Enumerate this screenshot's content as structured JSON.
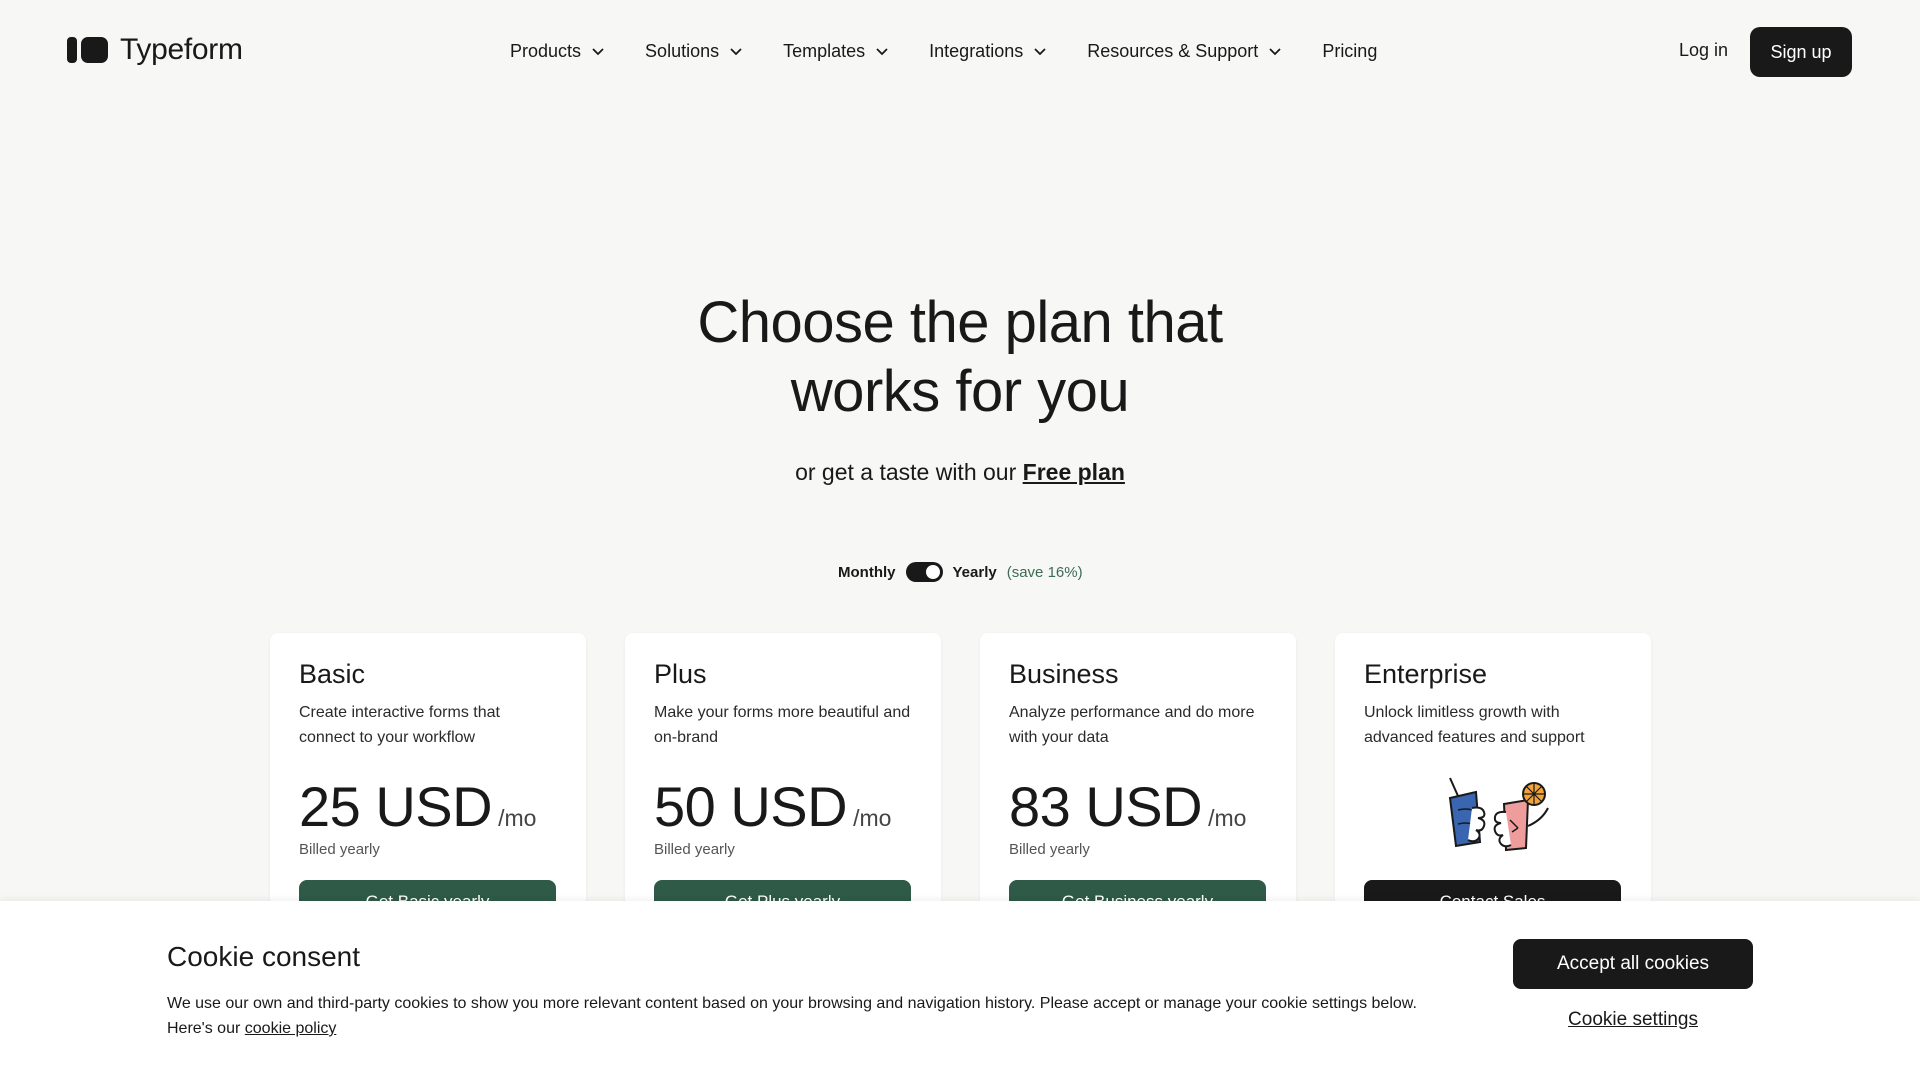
{
  "brand": {
    "name": "Typeform"
  },
  "nav": {
    "items": [
      {
        "label": "Products",
        "dropdown": true
      },
      {
        "label": "Solutions",
        "dropdown": true
      },
      {
        "label": "Templates",
        "dropdown": true
      },
      {
        "label": "Integrations",
        "dropdown": true
      },
      {
        "label": "Resources & Support",
        "dropdown": true
      },
      {
        "label": "Pricing",
        "dropdown": false
      }
    ],
    "login_label": "Log in",
    "signup_label": "Sign up"
  },
  "hero": {
    "title_line1": "Choose the plan that",
    "title_line2": "works for you",
    "subtitle_prefix": "or get a taste with our",
    "subtitle_link": "Free plan"
  },
  "billing_toggle": {
    "monthly_label": "Monthly",
    "yearly_label": "Yearly",
    "savings_label": "(save 16%)",
    "selected": "Yearly"
  },
  "plans": [
    {
      "name": "Basic",
      "description": "Create interactive forms that connect to your workflow",
      "amount": "25 USD",
      "period": "/mo",
      "billing": "Billed yearly",
      "cta": "Get Basic yearly"
    },
    {
      "name": "Plus",
      "description": "Make your forms more beautiful and on-brand",
      "amount": "50 USD",
      "period": "/mo",
      "billing": "Billed yearly",
      "cta": "Get Plus yearly"
    },
    {
      "name": "Business",
      "description": "Analyze performance and do more with your data",
      "amount": "83 USD",
      "period": "/mo",
      "billing": "Billed yearly",
      "cta": "Get Business yearly"
    },
    {
      "name": "Enterprise",
      "description": "Unlock limitless growth with advanced features and support",
      "cta": "Contact Sales",
      "illustration": "drinks-toast-icon"
    }
  ],
  "cookie": {
    "title": "Cookie consent",
    "body": "We use our own and third-party cookies to show you more relevant content based on your browsing and navigation history. Please accept or manage your cookie settings below. Here's our",
    "policy_link": "cookie policy",
    "accept_label": "Accept all cookies",
    "settings_label": "Cookie settings"
  },
  "colors": {
    "background": "#f7f7f5",
    "primary_dark": "#191919",
    "plan_button_green": "#2e5a47",
    "savings_green": "#3d6b55"
  }
}
